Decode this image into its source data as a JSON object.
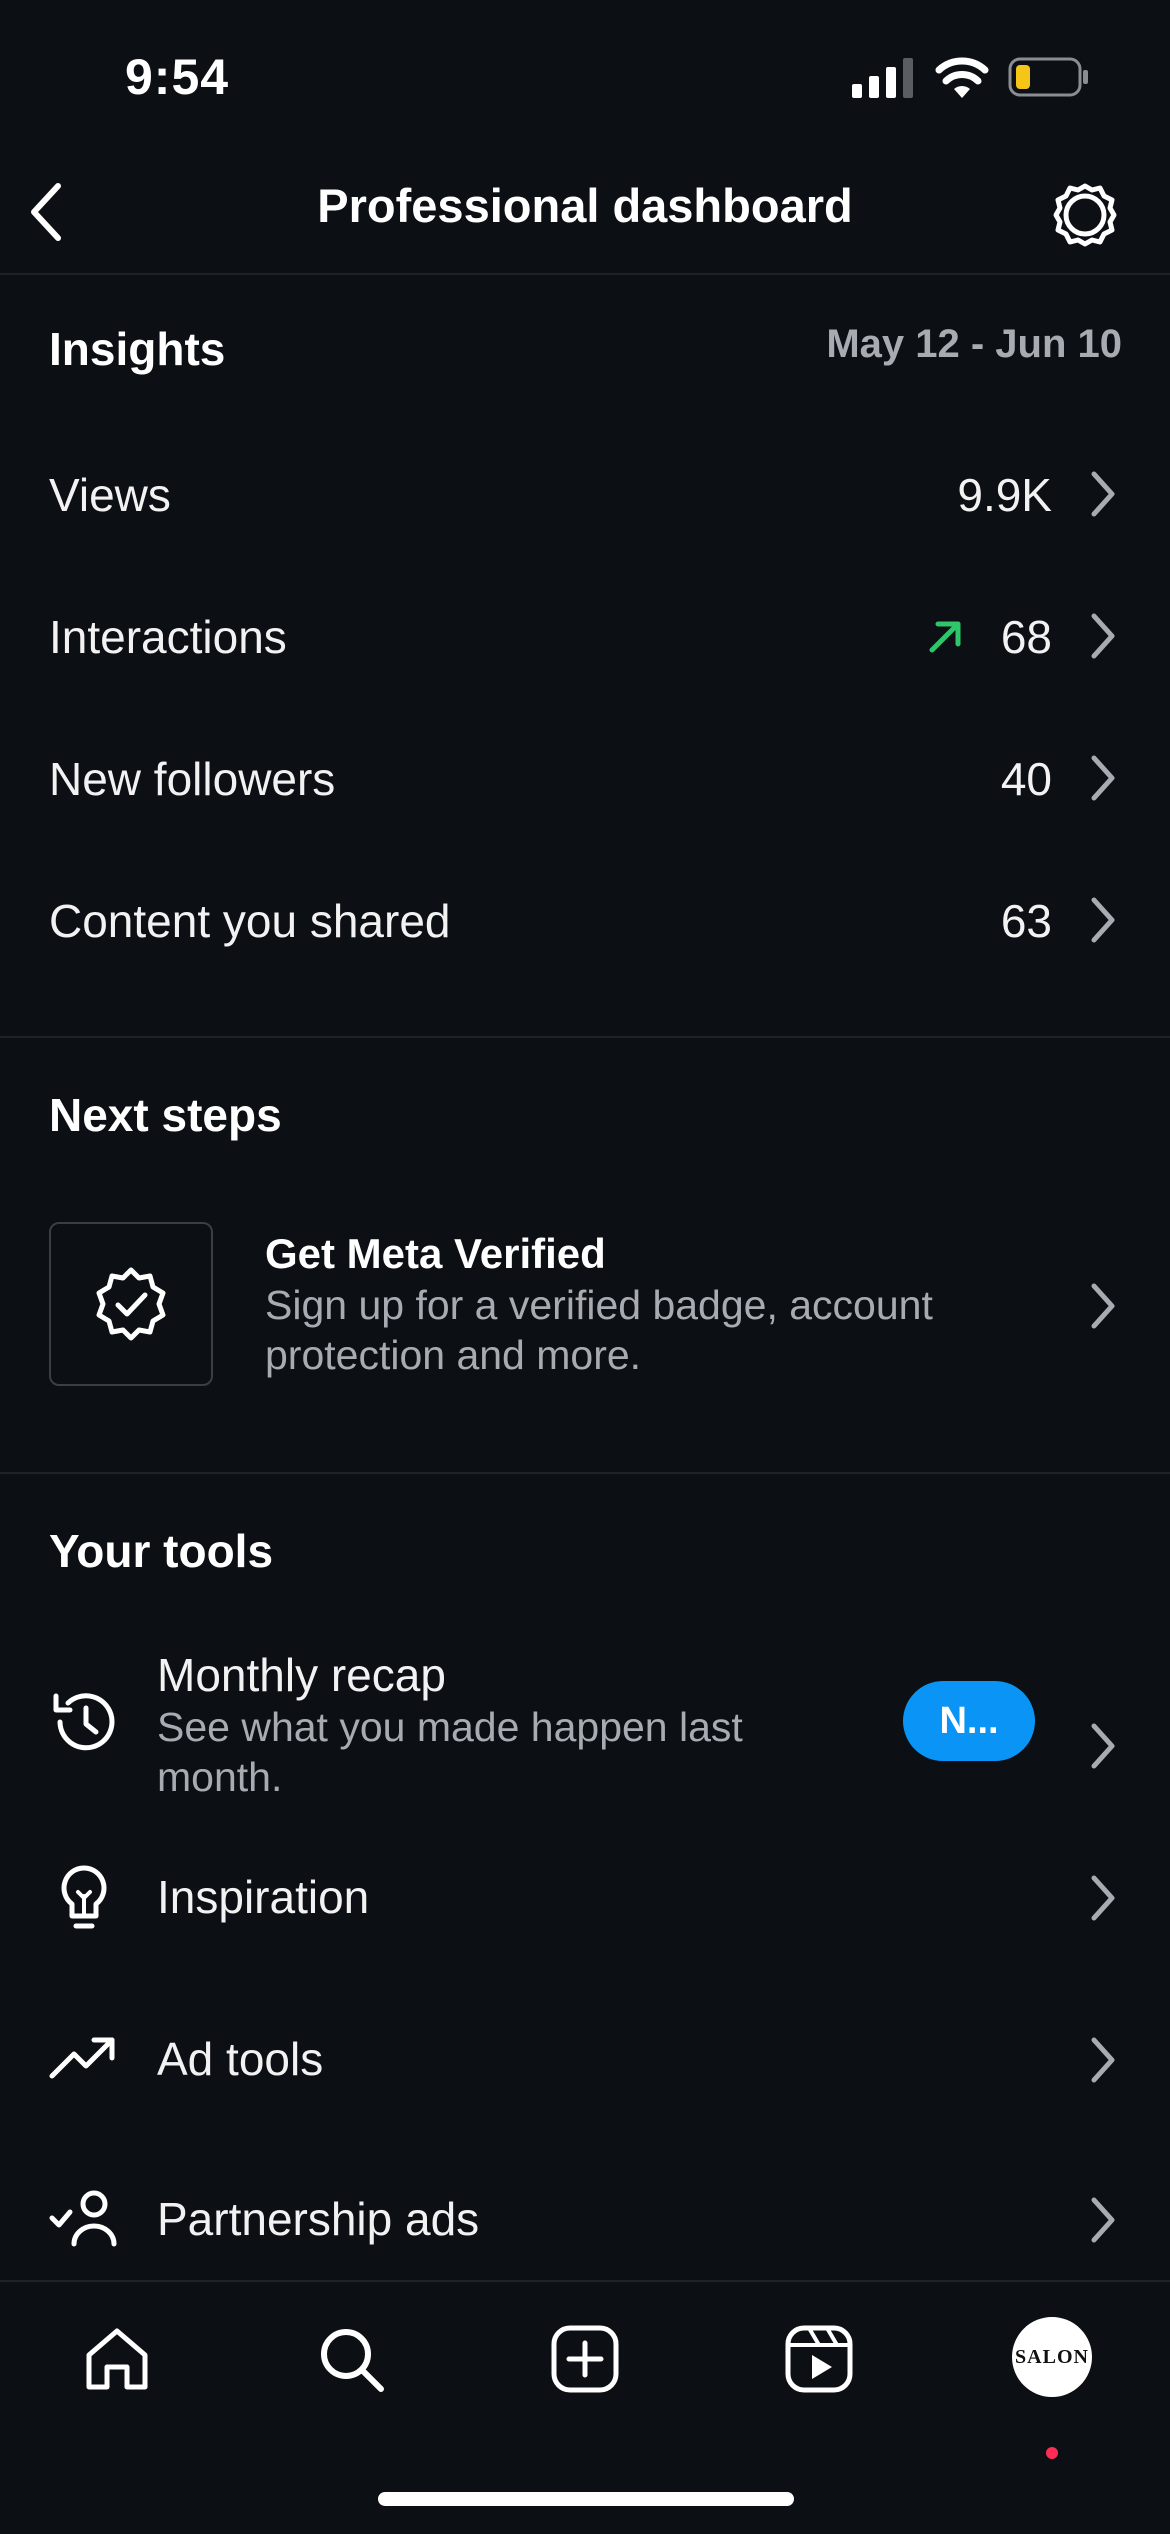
{
  "status": {
    "time": "9:54"
  },
  "nav": {
    "title": "Professional dashboard"
  },
  "insights": {
    "heading": "Insights",
    "date_range": "May 12 - Jun 10",
    "rows": [
      {
        "label": "Views",
        "value": "9.9K"
      },
      {
        "label": "Interactions",
        "value": "68",
        "trend": "up"
      },
      {
        "label": "New followers",
        "value": "40"
      },
      {
        "label": "Content you shared",
        "value": "63"
      }
    ]
  },
  "next_steps": {
    "heading": "Next steps",
    "item": {
      "title": "Get Meta Verified",
      "description": "Sign up for a verified badge, account protection and more."
    }
  },
  "tools": {
    "heading": "Your tools",
    "items": [
      {
        "label": "Monthly recap",
        "description": "See what you made happen last month.",
        "badge": "N...",
        "icon": "history-icon"
      },
      {
        "label": "Inspiration",
        "icon": "lightbulb-icon"
      },
      {
        "label": "Ad tools",
        "icon": "trending-up-icon"
      },
      {
        "label": "Partnership ads",
        "icon": "partnership-icon"
      }
    ]
  },
  "tab_bar": {
    "items": [
      "home-icon",
      "search-icon",
      "create-icon",
      "reels-icon",
      "profile-avatar"
    ],
    "avatar_text": "SALON"
  },
  "colors": {
    "background": "#0c0f14",
    "accent": "#0a95f6",
    "trend_up": "#2fc66b",
    "notification": "#ff2d55"
  }
}
